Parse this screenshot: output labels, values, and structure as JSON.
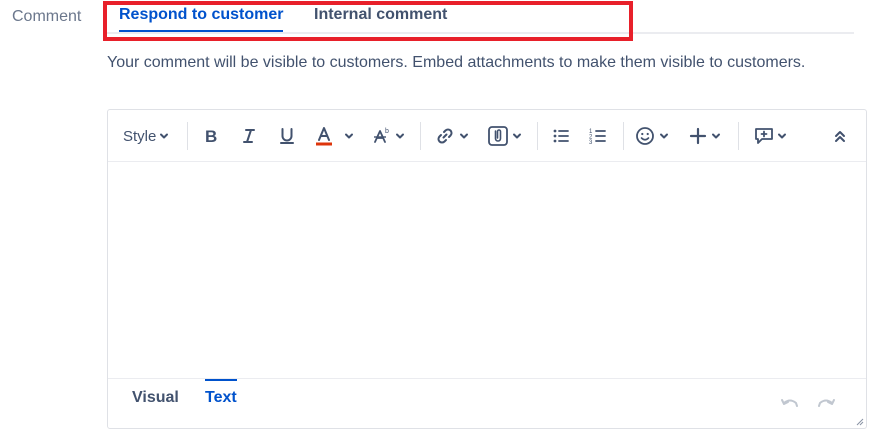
{
  "field": {
    "label": "Comment"
  },
  "tabs": [
    {
      "label": "Respond to customer",
      "active": true
    },
    {
      "label": "Internal comment",
      "active": false
    }
  ],
  "help_text": "Your comment will be visible to customers. Embed attachments to make them visible to customers.",
  "toolbar": {
    "style_label": "Style",
    "icons": [
      "bold-icon",
      "italic-icon",
      "underline-icon",
      "text-color-icon",
      "text-effects-icon",
      "link-icon",
      "attachment-icon",
      "bullet-list-icon",
      "numbered-list-icon",
      "emoji-icon",
      "insert-more-icon",
      "comment-macro-icon",
      "collapse-toolbar-icon"
    ]
  },
  "editor": {
    "value": ""
  },
  "modes": [
    {
      "label": "Visual",
      "active": false
    },
    {
      "label": "Text",
      "active": true
    }
  ],
  "colors": {
    "accent": "#0052cc",
    "highlight": "#e8202a",
    "text_color_underline": "#de350b"
  }
}
